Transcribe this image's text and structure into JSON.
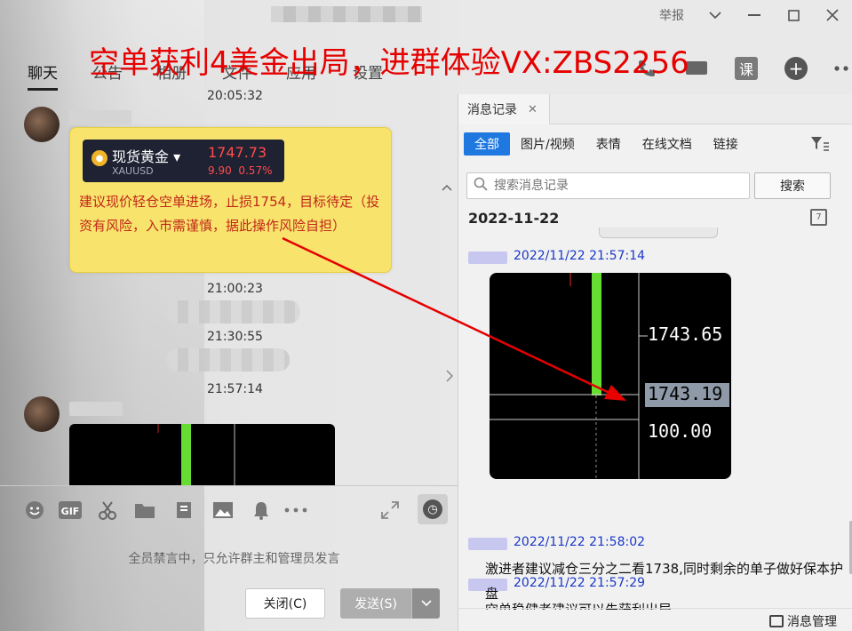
{
  "window": {
    "report_label": "举报",
    "min_icon": "minimize-icon",
    "max_icon": "maximize-icon",
    "close_icon": "close-icon"
  },
  "promo_banner": "空单获利4美金出局，进群体验VX:ZBS2256",
  "nav": {
    "tabs": [
      {
        "label": "聊天"
      },
      {
        "label": "公告"
      },
      {
        "label": "相册"
      },
      {
        "label": "文件"
      },
      {
        "label": "应用"
      },
      {
        "label": "设置"
      }
    ],
    "course_label": "课"
  },
  "chat": {
    "timestamps": [
      "20:05:32",
      "21:00:23",
      "21:30:55",
      "21:57:14"
    ],
    "ticker": {
      "name": "现货黄金",
      "symbol": "XAUUSD",
      "price": "1747.73",
      "change": "9.90",
      "change_pct": "0.57%"
    },
    "advice": "建议现价轻仓空单进场，止损1754，目标待定（投资有风险，入市需谨慎，据此操作风险自担）"
  },
  "composer": {
    "muted_note": "全员禁言中，只允许群主和管理员发言",
    "close_button": "关闭(C)",
    "send_button": "发送(S)"
  },
  "history": {
    "tab_label": "消息记录",
    "filters": [
      "全部",
      "图片/视频",
      "表情",
      "在线文档",
      "链接"
    ],
    "search_placeholder": "搜索消息记录",
    "search_button": "搜索",
    "date": "2022-11-22",
    "messages": [
      {
        "time": "2022/11/22 21:57:14",
        "text": ""
      },
      {
        "time": "2022/11/22 21:57:29",
        "text": "空单稳健者建议可以先获利出局"
      },
      {
        "time": "2022/11/22 21:58:02",
        "text": "激进者建议减仓三分之二看1738,同时剩余的单子做好保本护盘"
      }
    ],
    "chart_prices": {
      "upper": "1743.65",
      "current": "1743.19",
      "lower": "100.00"
    },
    "manage_label": "消息管理"
  },
  "colors": {
    "promo": "#e60000",
    "accent_blue": "#1e78e0",
    "advice_text": "#c2261a",
    "bubble": "#f8e46c",
    "candle_green": "#66dd33"
  }
}
